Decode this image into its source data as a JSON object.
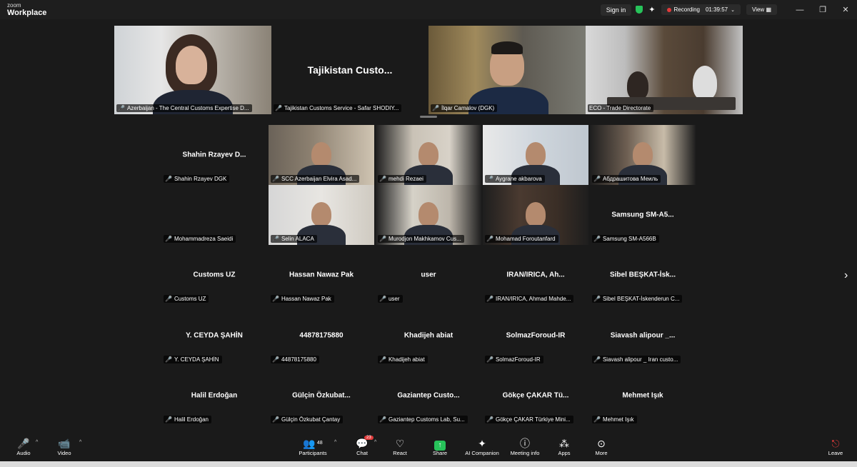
{
  "app": {
    "brand_top": "zoom",
    "brand_bottom": "Workplace"
  },
  "titlebar": {
    "sign_in": "Sign in",
    "recording_label": "Recording",
    "recording_time": "01:39:57",
    "view_label": "View",
    "minimize": "—",
    "restore": "❐",
    "close": "✕"
  },
  "top_strip": [
    {
      "name": "Azerbaijan - The Central Customs Expertise D...",
      "display": "",
      "video": true,
      "active": false
    },
    {
      "name": "Tajikistan Customs Service - Safar SHODIY...",
      "display": "Tajikistan Custo...",
      "video": false,
      "active": false
    },
    {
      "name": "İlqar Camalov (DGK)",
      "display": "",
      "video": true,
      "active": false
    },
    {
      "name": "ECO - Trade Directorate",
      "display": "",
      "video": true,
      "active": true
    }
  ],
  "grid": [
    {
      "name": "Shahin Rzayev DGK",
      "display": "Shahin Rzayev D...",
      "video": false
    },
    {
      "name": "SCC Azerbaijan Elvira Asad...",
      "display": "",
      "video": true
    },
    {
      "name": "mehdi Rezaei",
      "display": "",
      "video": true
    },
    {
      "name": "Aygrane akbarova",
      "display": "",
      "video": true
    },
    {
      "name": "Абдрашитова Меиль",
      "display": "",
      "video": true
    },
    {
      "name": "Mohammadreza Saeidi",
      "display": "",
      "video": false
    },
    {
      "name": "Selin ALACA",
      "display": "",
      "video": true
    },
    {
      "name": "Murodjon Makhkamov Cus...",
      "display": "",
      "video": true
    },
    {
      "name": "Mohamad Foroutanfard",
      "display": "",
      "video": true
    },
    {
      "name": "Samsung SM-A566B",
      "display": "Samsung SM-A5...",
      "video": false
    },
    {
      "name": "Customs UZ",
      "display": "Customs UZ",
      "video": false
    },
    {
      "name": "Hassan Nawaz Pak",
      "display": "Hassan Nawaz Pak",
      "video": false
    },
    {
      "name": "user",
      "display": "user",
      "video": false
    },
    {
      "name": "IRAN/IRICA, Ahmad Mahde...",
      "display": "IRAN/IRICA,  Ah...",
      "video": false
    },
    {
      "name": "Sibel BEŞKAT-İskenderun C...",
      "display": "Sibel  BEŞKAT-İsk...",
      "video": false
    },
    {
      "name": "Y. CEYDA ŞAHİN",
      "display": "Y. CEYDA ŞAHİN",
      "video": false
    },
    {
      "name": "44878175880",
      "display": "44878175880",
      "video": false
    },
    {
      "name": "Khadijeh abiat",
      "display": "Khadijeh abiat",
      "video": false
    },
    {
      "name": "SolmazForoud-IR",
      "display": "SolmazForoud-IR",
      "video": false
    },
    {
      "name": "Siavash alipour _ Iran custo...",
      "display": "Siavash alipour _...",
      "video": false
    },
    {
      "name": "Halil Erdoğan",
      "display": "Halil Erdoğan",
      "video": false
    },
    {
      "name": "Gülçin Özkubat Çantay",
      "display": "Gülçin Özkubat...",
      "video": false
    },
    {
      "name": "Gaziantep Customs Lab, Su...",
      "display": "Gaziantep  Custo...",
      "video": false
    },
    {
      "name": "Gökçe ÇAKAR Türkiye Mini...",
      "display": "Gökçe  ÇAKAR  Tü...",
      "video": false
    },
    {
      "name": "Mehmet Işık",
      "display": "Mehmet Işık",
      "video": false
    }
  ],
  "toolbar": {
    "audio": "Audio",
    "video": "Video",
    "participants": "Participants",
    "participants_count": "48",
    "chat": "Chat",
    "chat_badge": "23",
    "react": "React",
    "share": "Share",
    "ai_companion": "AI Companion",
    "meeting_info": "Meeting info",
    "apps": "Apps",
    "more": "More",
    "leave": "Leave"
  },
  "colors": {
    "active_border": "#2fc15c",
    "mute_red": "#e23b3b",
    "share_green": "#27c35a"
  }
}
